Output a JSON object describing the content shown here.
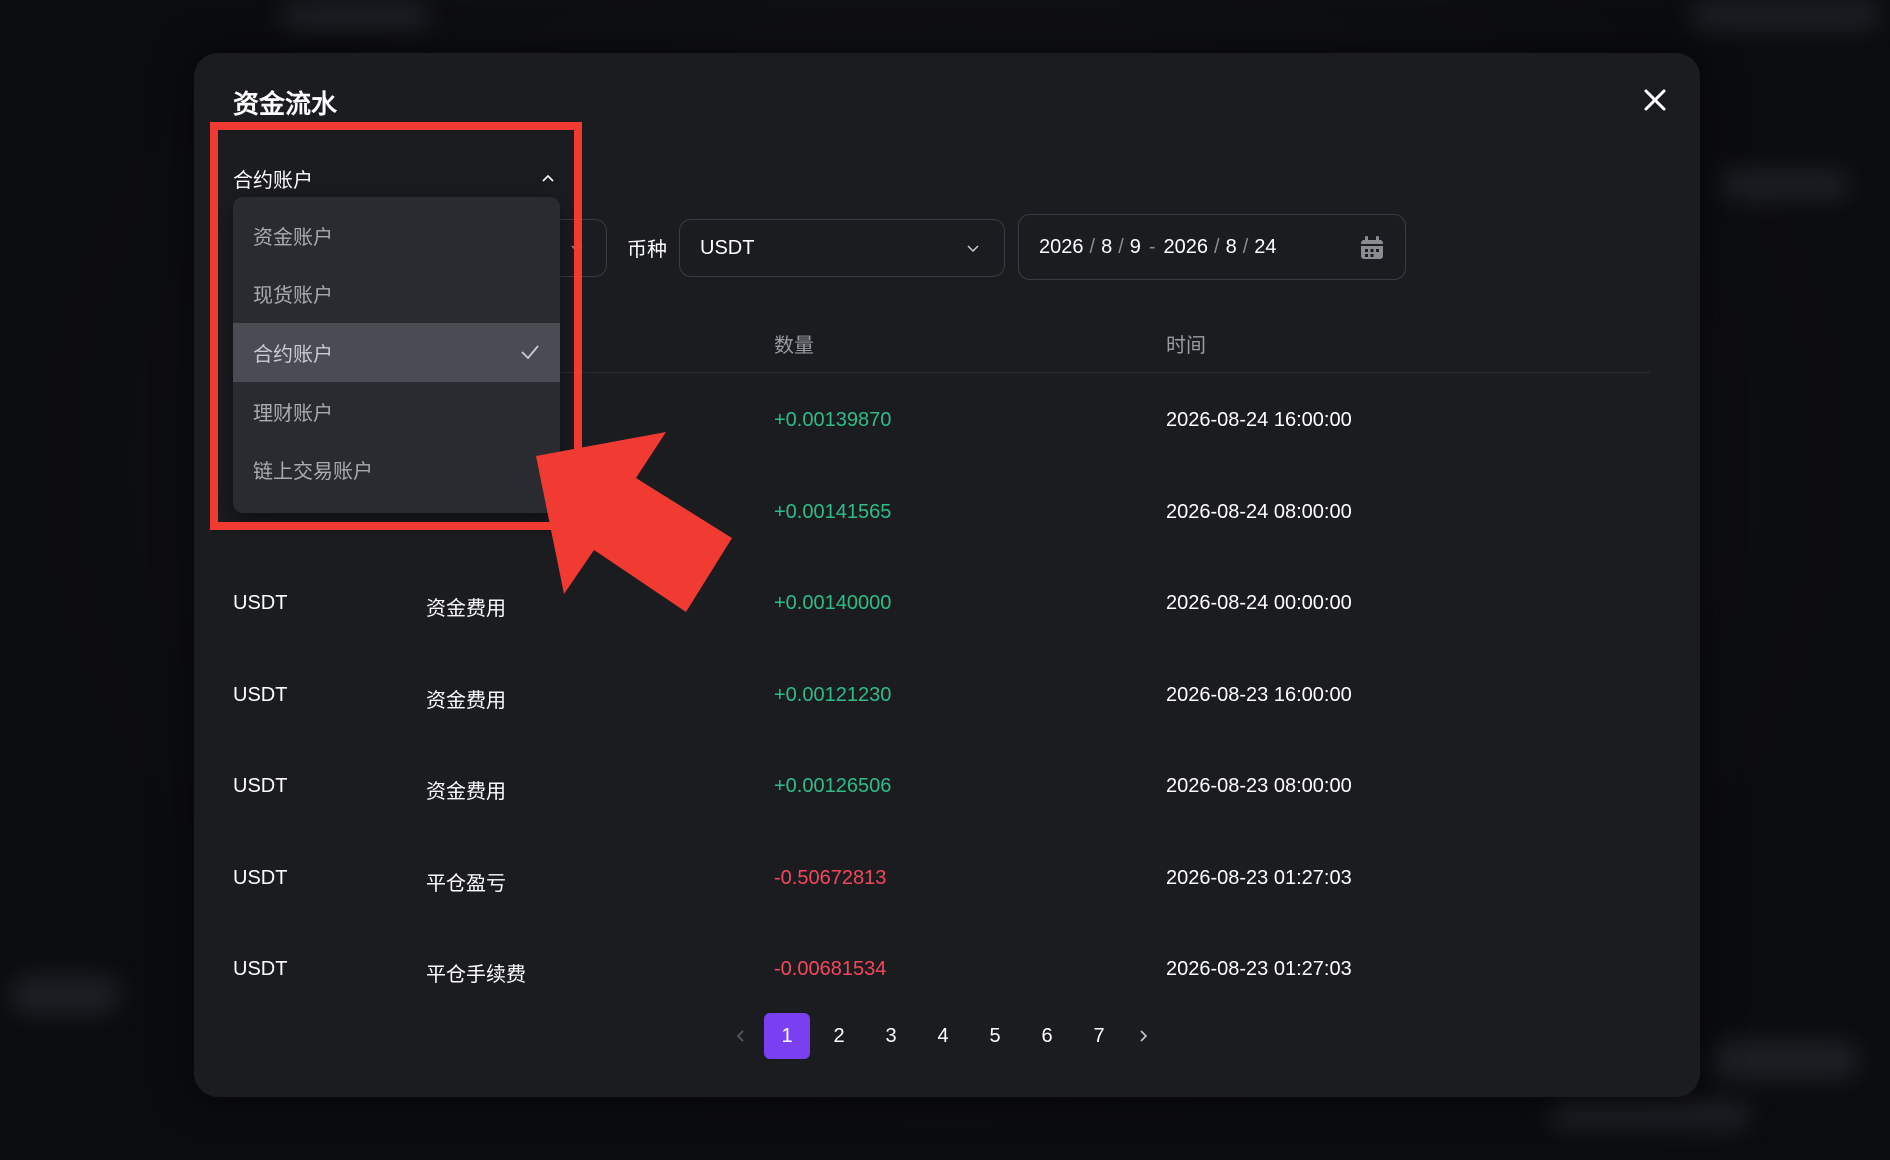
{
  "modal": {
    "title": "资金流水"
  },
  "filters": {
    "account_selected": "合约账户",
    "coin_label": "币种",
    "coin_value": "USDT",
    "date_start": {
      "year": "2026",
      "month": "8",
      "day": "9"
    },
    "date_end": {
      "year": "2026",
      "month": "8",
      "day": "24"
    },
    "date_separator": "-",
    "date_slash": "/"
  },
  "dropdown": {
    "items": [
      {
        "label": "资金账户",
        "selected": false
      },
      {
        "label": "现货账户",
        "selected": false
      },
      {
        "label": "合约账户",
        "selected": true
      },
      {
        "label": "理财账户",
        "selected": false
      },
      {
        "label": "链上交易账户",
        "selected": false
      }
    ]
  },
  "table": {
    "headers": {
      "amount": "数量",
      "time": "时间"
    },
    "rows": [
      {
        "coin": "",
        "type": "",
        "amount": "+0.00139870",
        "time": "2026-08-24 16:00:00"
      },
      {
        "coin": "",
        "type": "",
        "amount": "+0.00141565",
        "time": "2026-08-24 08:00:00"
      },
      {
        "coin": "USDT",
        "type": "资金费用",
        "amount": "+0.00140000",
        "time": "2026-08-24 00:00:00"
      },
      {
        "coin": "USDT",
        "type": "资金费用",
        "amount": "+0.00121230",
        "time": "2026-08-23 16:00:00"
      },
      {
        "coin": "USDT",
        "type": "资金费用",
        "amount": "+0.00126506",
        "time": "2026-08-23 08:00:00"
      },
      {
        "coin": "USDT",
        "type": "平仓盈亏",
        "amount": "-0.50672813",
        "time": "2026-08-23 01:27:03"
      },
      {
        "coin": "USDT",
        "type": "平仓手续费",
        "amount": "-0.00681534",
        "time": "2026-08-23 01:27:03"
      }
    ]
  },
  "pagination": {
    "pages": [
      "1",
      "2",
      "3",
      "4",
      "5",
      "6",
      "7"
    ],
    "current": "1"
  },
  "colors": {
    "positive": "#2ebd85",
    "negative": "#f6465d",
    "accent": "#7b3ff2",
    "annotation": "#f03a32"
  }
}
